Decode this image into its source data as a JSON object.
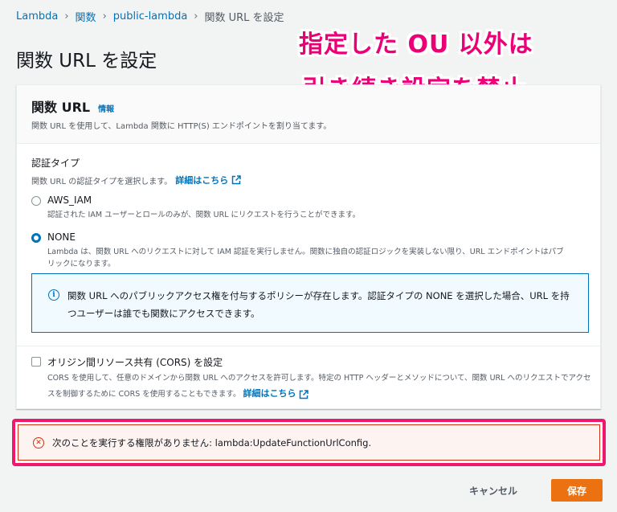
{
  "breadcrumb": {
    "items": [
      "Lambda",
      "関数",
      "public-lambda"
    ],
    "current": "関数 URL を設定"
  },
  "page_title": "関数 URL を設定",
  "annotation": {
    "line1": "指定した OU 以外は",
    "line2": "引き続き設定を禁止"
  },
  "panel": {
    "title": "関数 URL",
    "info_link": "情報",
    "description": "関数 URL を使用して、Lambda 関数に HTTP(S) エンドポイントを割り当てます。"
  },
  "auth_type": {
    "label": "認証タイプ",
    "description": "関数 URL の認証タイプを選択します。",
    "details_link": "詳細はこちら",
    "options": [
      {
        "label": "AWS_IAM",
        "description": "認証された IAM ユーザーとロールのみが、関数 URL にリクエストを行うことができます。",
        "selected": false
      },
      {
        "label": "NONE",
        "description": "Lambda は、関数 URL へのリクエストに対して IAM 認証を実行しません。関数に独自の認証ロジックを実装しない限り、URL エンドポイントはパブリックになります。",
        "selected": true
      }
    ]
  },
  "info_alert": {
    "text": "関数 URL へのパブリックアクセス権を付与するポリシーが存在します。認証タイプの NONE を選択した場合、URL を持つユーザーは誰でも関数にアクセスできます。"
  },
  "cors": {
    "label": "オリジン間リソース共有 (CORS) を設定",
    "description": "CORS を使用して、任意のドメインから関数 URL へのアクセスを許可します。特定の HTTP ヘッダーとメソッドについて、関数 URL へのリクエストでアクセスを制御するために CORS を使用することもできます。",
    "details_link": "詳細はこちら",
    "checked": false
  },
  "error": {
    "text": "次のことを実行する権限がありません: lambda:UpdateFunctionUrlConfig."
  },
  "actions": {
    "cancel": "キャンセル",
    "save": "保存"
  },
  "colors": {
    "link": "#0073bb",
    "primary_button": "#ec7211",
    "annotation": "#ec0078",
    "error_border": "#f0186e"
  }
}
